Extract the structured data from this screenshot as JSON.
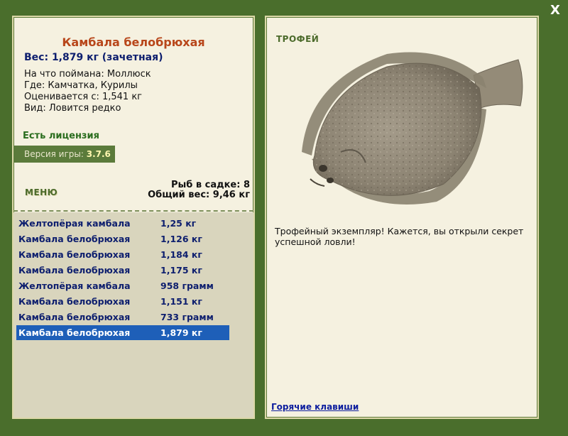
{
  "close_label": "X",
  "fish": {
    "title": "Камбала белобрюхая",
    "weight": "Вес: 1,879 кг (зачетная)",
    "caught_on": "На что поймана: Моллюск",
    "location": "Где: Камчатка, Курилы",
    "valued_from": "Оценивается с: 1,541 кг",
    "kind": "Вид: Ловится редко"
  },
  "license": "Есть лицензия",
  "version": {
    "label": "Версия игры:",
    "value": "3.7.6"
  },
  "menu_label": "МЕНЮ",
  "stats": {
    "count": "Рыб в садке: 8",
    "total": "Общий вес: 9,46 кг"
  },
  "catch_list": [
    {
      "name": "Желтопёрая камбала",
      "weight": "1,25 кг"
    },
    {
      "name": "Камбала белобрюхая",
      "weight": "1,126 кг"
    },
    {
      "name": "Камбала белобрюхая",
      "weight": "1,184 кг"
    },
    {
      "name": "Камбала белобрюхая",
      "weight": "1,175 кг"
    },
    {
      "name": "Желтопёрая камбала",
      "weight": "958 грамм"
    },
    {
      "name": "Камбала белобрюхая",
      "weight": "1,151 кг"
    },
    {
      "name": "Камбала белобрюхая",
      "weight": "733 грамм"
    },
    {
      "name": "Камбала белобрюхая",
      "weight": "1,879 кг"
    }
  ],
  "trophy": {
    "label": "ТРОФЕЙ",
    "text": "Трофейный экземпляр! Кажется, вы открыли секрет успешной ловли!",
    "image_icon": "flounder-fish-illustration"
  },
  "hotkeys_label": "Горячие клавиши",
  "colors": {
    "background": "#4a6e2c",
    "panel": "#f5f1e0",
    "title": "#b8461a",
    "text_blue": "#0d1e6e",
    "license_green": "#2a6d1e",
    "selected_row": "#1e5fb8"
  }
}
